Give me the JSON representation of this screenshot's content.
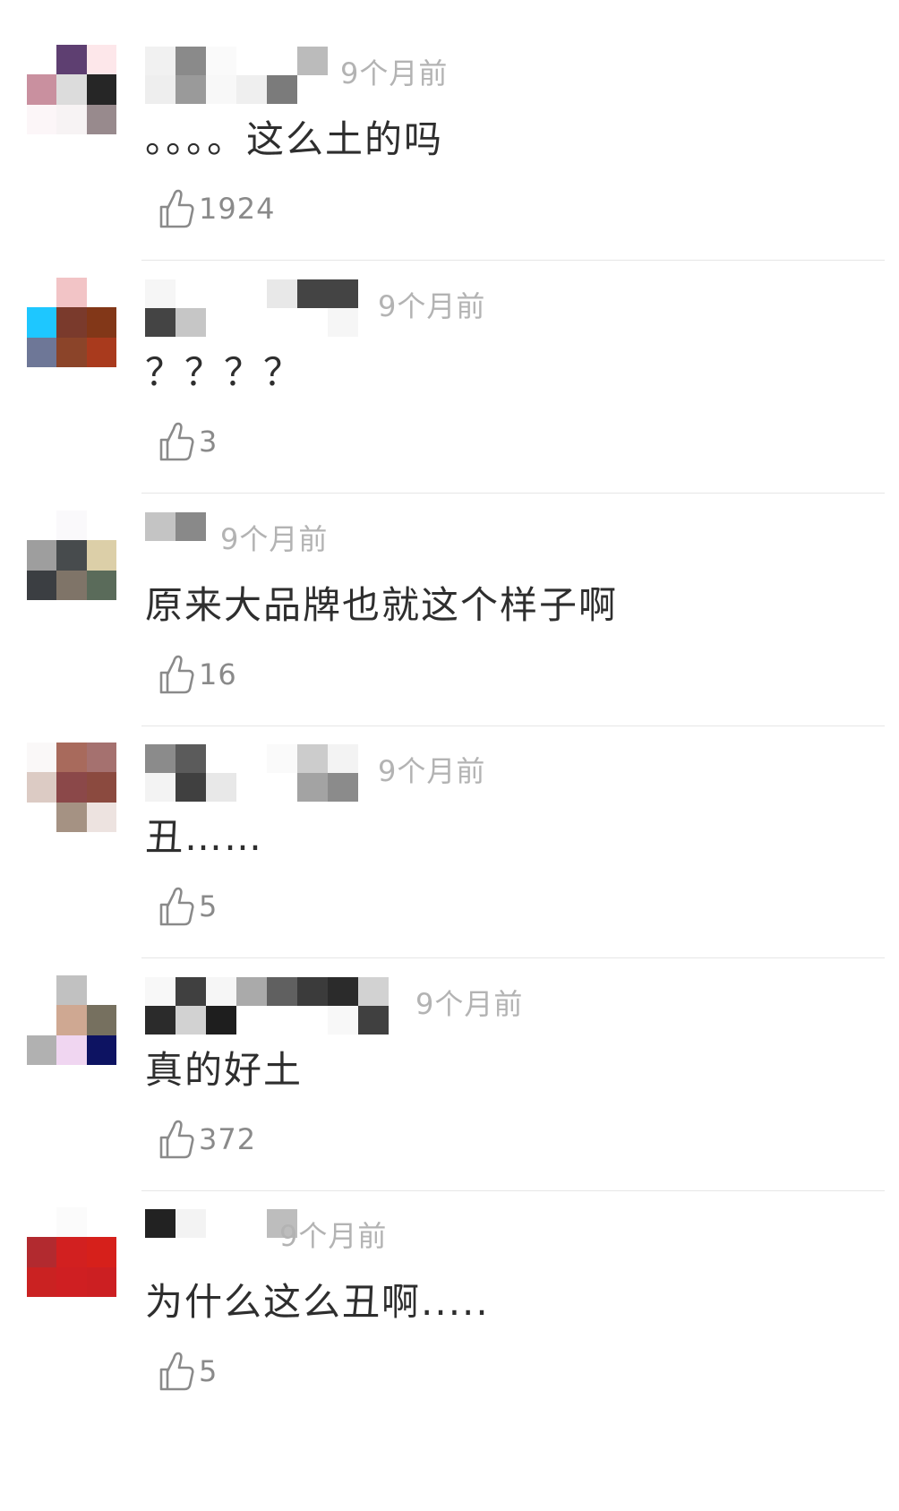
{
  "comments": [
    {
      "time": "9个月前",
      "text": "。。。。这么土的吗",
      "likes": "1924",
      "avatar": [
        "#ffffff",
        "#5e3f71",
        "#fde7ea",
        "#c9909f",
        "#dcdcdc",
        "#262626",
        "#fcf6f8",
        "#f7f3f4",
        "#988a8d"
      ],
      "name": [
        "#f1f1f1",
        "#8a8a8a",
        "#fafafa",
        "#ffffff",
        "#ffffff",
        "#bbbbbb",
        "#eeeeee",
        "#9a9a9a",
        "#f8f8f8",
        "#efefef",
        "#7b7b7b",
        "#ffffff"
      ]
    },
    {
      "time": "9个月前",
      "text": "？？？？",
      "likes": "3",
      "avatar": [
        "#ffffff",
        "#f2c4c6",
        "#ffffff",
        "#1ec7ff",
        "#7a3a2c",
        "#823718",
        "#6e7797",
        "#8b4429",
        "#a93a1d"
      ],
      "name": [
        "#f6f6f6",
        "#ffffff",
        "#ffffff",
        "#ffffff",
        "#e8e8e8",
        "#444444",
        "#444444",
        "#c6c6c6",
        "#ffffff",
        "#ffffff",
        "#ffffff",
        "#ffffff"
      ]
    },
    {
      "time": "9个月前",
      "text": "原来大品牌也就这个样子啊",
      "likes": "16",
      "avatar": [
        "#ffffff",
        "#faf9fb",
        "#ffffff",
        "#9e9e9e",
        "#474b4d",
        "#dccfa8",
        "#3b3e42",
        "#7f7468",
        "#5a6b5a"
      ],
      "name": [
        "#c4c4c4",
        "#898989",
        "#ffffff",
        "#ffffff",
        "#ffffff",
        "#ffffff",
        "#ffffff",
        "#ffffff",
        "#ffffff",
        "#ffffff",
        "#ffffff",
        "#ffffff"
      ]
    },
    {
      "time": "9个月前",
      "text": "丑……",
      "likes": "5",
      "avatar": [
        "#faf8f8",
        "#a86a5c",
        "#a5716f",
        "#dccbc4",
        "#8b4849",
        "#8b4a3f",
        "#ffffff",
        "#a59283",
        "#ede3e0"
      ],
      "name": [
        "#8b8b8b",
        "#5b5b5b",
        "#ffffff",
        "#ffffff",
        "#fafafa",
        "#cccccc",
        "#f3f3f3",
        "#404040",
        "#e8e8e8",
        "#ffffff",
        "#ffffff",
        "#a3a3a3"
      ]
    },
    {
      "time": "9个月前",
      "text": "真的好土",
      "likes": "372",
      "avatar": [
        "#ffffff",
        "#c1c1c1",
        "#ffffff",
        "#ffffff",
        "#cfa892",
        "#76705f",
        "#b1b1b1",
        "#f0d6f1",
        "#0d1362"
      ],
      "name": [
        "#f8f8f8",
        "#404040",
        "#f6f6f6",
        "#aaaaaa",
        "#606060",
        "#3b3b3b",
        "#2b2b2b",
        "#d2d2d2",
        "#1e1e1e",
        "#ffffff",
        "#ffffff",
        "#ffffff"
      ]
    },
    {
      "time": "9个月前",
      "text": "为什么这么丑啊.....",
      "likes": "5",
      "avatar": [
        "#ffffff",
        "#fbfbfb",
        "#ffffff",
        "#b22a2f",
        "#d22020",
        "#d6201b",
        "#ca2222",
        "#cf1f22",
        "#cc1f22"
      ],
      "name": [
        "#222222",
        "#f3f3f3",
        "#ffffff",
        "#ffffff",
        "#bdbdbd",
        "#ffffff",
        "#ffffff",
        "#ffffff",
        "#ffffff",
        "#ffffff",
        "#ffffff",
        "#ffffff"
      ]
    }
  ]
}
